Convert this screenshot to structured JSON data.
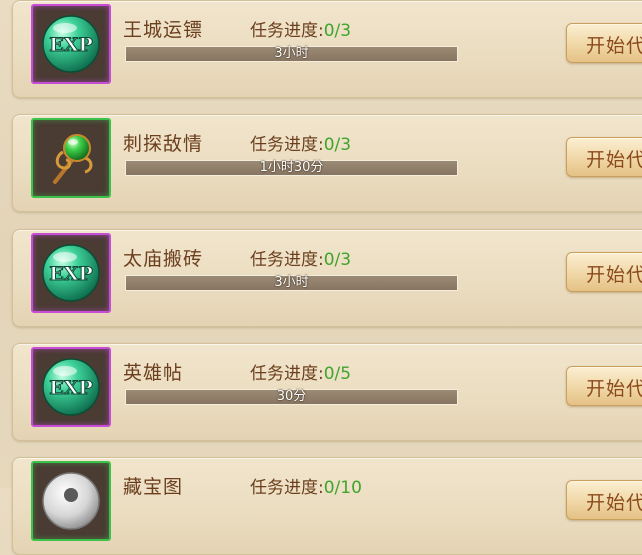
{
  "progress_prefix": "任务进度:",
  "tasks": [
    {
      "name": "王城运镖",
      "progress": "0/3",
      "time": "3小时",
      "icon": "exp-orb-icon",
      "button": "开始代"
    },
    {
      "name": "刺探敌情",
      "progress": "0/3",
      "time": "1小时30分",
      "icon": "green-gem-staff-icon",
      "button": "开始代"
    },
    {
      "name": "太庙搬砖",
      "progress": "0/3",
      "time": "3小时",
      "icon": "exp-orb-icon",
      "button": "开始代"
    },
    {
      "name": "英雄帖",
      "progress": "0/5",
      "time": "30分",
      "icon": "exp-orb-icon",
      "button": "开始代"
    },
    {
      "name": "藏宝图",
      "progress": "0/10",
      "time": "",
      "icon": "white-orb-icon",
      "button": "开始代"
    }
  ],
  "colors": {
    "purple_frame": "#c74cd6",
    "green_frame": "#3cc24a",
    "progress_value": "#3fa42c",
    "title_text": "#6b3f1e"
  }
}
